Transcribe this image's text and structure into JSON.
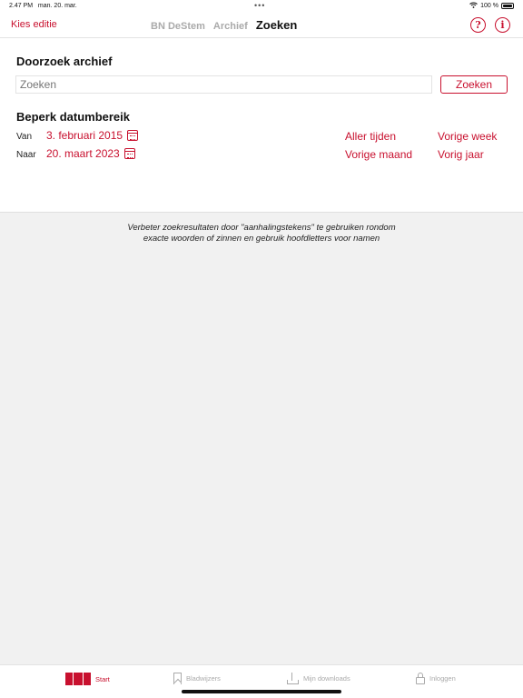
{
  "status": {
    "time": "2.47 PM",
    "date": "man. 20. mar.",
    "battery": "100 %"
  },
  "nav": {
    "left_label": "Kies editie",
    "tabs": [
      {
        "label": "BN DeStem"
      },
      {
        "label": "Archief"
      },
      {
        "label": "Zoeken"
      }
    ],
    "help_glyph": "?",
    "info_glyph": "i"
  },
  "search": {
    "title": "Doorzoek archief",
    "placeholder": "Zoeken",
    "button_label": "Zoeken"
  },
  "dates": {
    "title": "Beperk datumbereik",
    "from_label": "Van",
    "from_value": "3. februari 2015",
    "to_label": "Naar",
    "to_value": "20. maart 2023",
    "quick": {
      "all_time": "Aller tijden",
      "last_week": "Vorige week",
      "last_month": "Vorige maand",
      "last_year": "Vorig jaar"
    }
  },
  "hint": "Verbeter zoekresultaten door \"aanhalingstekens\" te gebruiken rondom exacte woorden of zinnen en gebruik hoofdletters voor namen",
  "tabbar": {
    "start": "Start",
    "bookmarks": "Bladwijzers",
    "downloads": "Mijn downloads",
    "login": "Inloggen"
  },
  "colors": {
    "accent": "#c8102e"
  }
}
